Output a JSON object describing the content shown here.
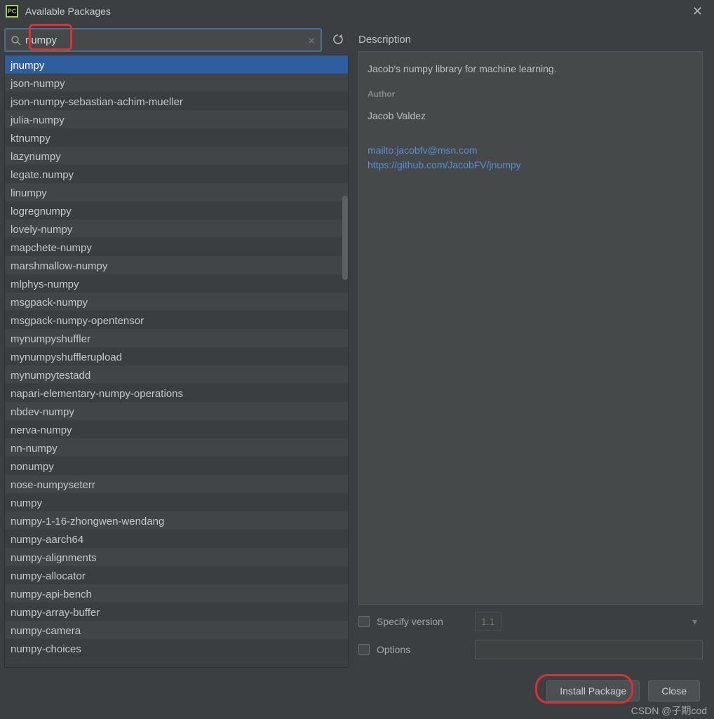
{
  "window": {
    "title": "Available Packages",
    "app_icon_text": "PC"
  },
  "search": {
    "value": "numpy",
    "placeholder": ""
  },
  "packages": [
    "jnumpy",
    "json-numpy",
    "json-numpy-sebastian-achim-mueller",
    "julia-numpy",
    "ktnumpy",
    "lazynumpy",
    "legate.numpy",
    "linumpy",
    "logregnumpy",
    "lovely-numpy",
    "mapchete-numpy",
    "marshmallow-numpy",
    "mlphys-numpy",
    "msgpack-numpy",
    "msgpack-numpy-opentensor",
    "mynumpyshuffler",
    "mynumpyshufflerupload",
    "mynumpytestadd",
    "napari-elementary-numpy-operations",
    "nbdev-numpy",
    "nerva-numpy",
    "nn-numpy",
    "nonumpy",
    "nose-numpyseterr",
    "numpy",
    "numpy-1-16-zhongwen-wendang",
    "numpy-aarch64",
    "numpy-alignments",
    "numpy-allocator",
    "numpy-api-bench",
    "numpy-array-buffer",
    "numpy-camera",
    "numpy-choices"
  ],
  "selected_index": 0,
  "description": {
    "heading": "Description",
    "summary": "Jacob's numpy library for machine learning.",
    "author_label": "Author",
    "author": "Jacob Valdez",
    "mailto": "mailto:jacobfv@msn.com",
    "repo": "https://github.com/JacobFV/jnumpy"
  },
  "specify_version": {
    "label": "Specify version",
    "value": "1.1",
    "checked": false
  },
  "options": {
    "label": "Options",
    "value": "",
    "checked": false
  },
  "buttons": {
    "install": "Install Package",
    "close": "Close"
  },
  "watermark": "CSDN @子期cod"
}
